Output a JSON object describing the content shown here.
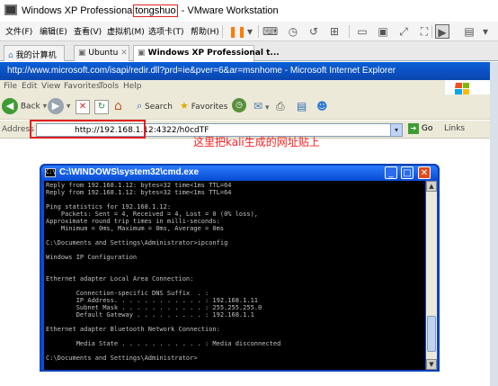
{
  "vmware": {
    "title_before": "Windows XP Professiona",
    "title_highlight": "tongshuo",
    "title_after": " - VMware Workstation",
    "menu": [
      "文件(F)",
      "编辑(E)",
      "查看(V)",
      "虚拟机(M)",
      "选项卡(T)",
      "帮助(H)"
    ],
    "tabs": [
      "我的计算机",
      "Ubuntu",
      "Windows XP Professional t..."
    ]
  },
  "ie": {
    "title": "http://www.microsoft.com/isapi/redir.dll?prd=ie&pver=6&ar=msnhome - Microsoft Internet Explorer",
    "menu": [
      "File",
      "Edit",
      "View",
      "Favorites",
      "Tools",
      "Help"
    ],
    "toolbar": {
      "back": "Back",
      "search": "Search",
      "favorites": "Favorites"
    },
    "address_label": "Address",
    "address_value": "http://192.168.1.12:4322/h0cdTF",
    "go_label": "Go",
    "links_label": "Links"
  },
  "annotation": "这里把kali生成的网址贴上",
  "cmd": {
    "title": "C:\\WINDOWS\\system32\\cmd.exe",
    "lines": [
      "Reply from 192.168.1.12: bytes=32 time<1ms TTL=64",
      "Reply from 192.168.1.12: bytes=32 time<1ms TTL=64",
      "",
      "Ping statistics for 192.168.1.12:",
      "    Packets: Sent = 4, Received = 4, Lost = 0 (0% loss),",
      "Approximate round trip times in milli-seconds:",
      "    Minimum = 0ms, Maximum = 0ms, Average = 0ms",
      "",
      "C:\\Documents and Settings\\Administrator>ipconfig",
      "",
      "Windows IP Configuration",
      "",
      "",
      "Ethernet adapter Local Area Connection:",
      "",
      "        Connection-specific DNS Suffix  . :",
      "        IP Address. . . . . . . . . . . . : 192.168.1.11",
      "        Subnet Mask . . . . . . . . . . . : 255.255.255.0",
      "        Default Gateway . . . . . . . . . : 192.168.1.1",
      "",
      "Ethernet adapter Bluetooth Network Connection:",
      "",
      "        Media State . . . . . . . . . . . : Media disconnected",
      "",
      "C:\\Documents and Settings\\Administrator>"
    ]
  }
}
